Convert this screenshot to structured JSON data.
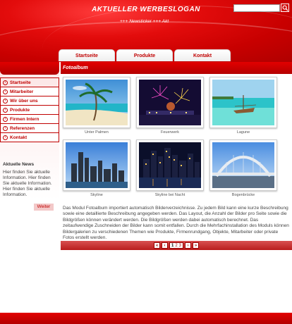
{
  "header": {
    "slogan": "AKTUELLER WERBESLOGAN",
    "ticker": "+++ Newsticker +++ Akt",
    "search": {
      "value": "",
      "placeholder": ""
    }
  },
  "topnav": {
    "tabs": [
      {
        "label": "Startseite"
      },
      {
        "label": "Produkte"
      },
      {
        "label": "Kontakt"
      }
    ]
  },
  "sidebar": {
    "menu": [
      {
        "label": "Startseite"
      },
      {
        "label": "Mitarbeiter"
      },
      {
        "label": "Wir über uns"
      },
      {
        "label": "Produkte"
      },
      {
        "label": "Firmen Intern"
      },
      {
        "label": "Referenzen"
      },
      {
        "label": "Kontakt"
      }
    ],
    "news": {
      "title": "Aktuelle News",
      "text": "Hier finden Sie aktuelle Information. Hier finden Sie aktuelle Information. Hier finden Sie aktuelle Information.",
      "more_label": "Weiter"
    }
  },
  "main": {
    "title": "Fotoalbum",
    "photos": [
      {
        "caption": "Unter Palmen",
        "icon": "beach-palm-image"
      },
      {
        "caption": "Feuerwerk",
        "icon": "fireworks-image"
      },
      {
        "caption": "Lagune",
        "icon": "lagoon-boat-image"
      },
      {
        "caption": "Skyline",
        "icon": "city-skyline-image"
      },
      {
        "caption": "Skyline bei Nacht",
        "icon": "night-skyline-image"
      },
      {
        "caption": "Bogenbrücke",
        "icon": "arch-bridge-image"
      }
    ],
    "description": "Das Modul Fotoalbum importiert automatisch Bilderverzeichnisse. Zu jedem Bild kann eine kurze Beschreibung sowie eine detaillierte Beschreibung angegeben werden. Das Layout, die Anzahl der Bilder pro Seite sowie die Bildgrößen können verändert werden. Die Bildgrößen werden dabei automatisch berechnet. Das zeitaufwendige Zuschneiden der Bilder kann somit entfallen. Durch die Mehrfachinstallation des Moduls können Bildergalerien zu verschiedenen Themen wie Produkte, Firmenrundgang, Objekte, Mitarbeiter oder private Fotos erstellt werden.",
    "pager": {
      "first": "«",
      "prev": "‹",
      "pages": [
        "1",
        "2",
        "3"
      ],
      "current": "1",
      "next": "›",
      "last": "»"
    }
  },
  "colors": {
    "brand_red": "#c00000",
    "header_red": "#e30c0c"
  }
}
